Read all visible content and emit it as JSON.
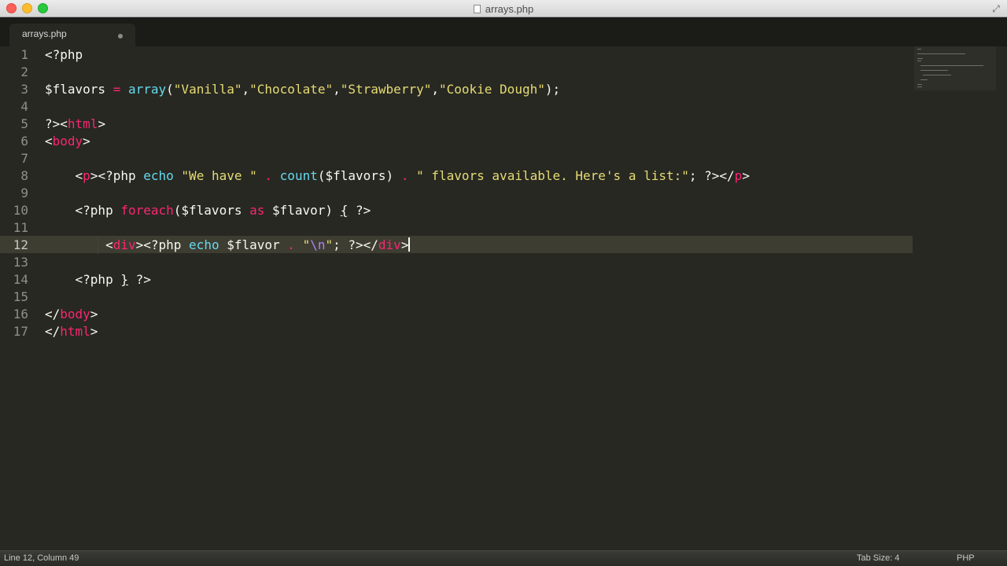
{
  "window": {
    "title": "arrays.php"
  },
  "tabs": [
    {
      "label": "arrays.php",
      "dirty": true
    }
  ],
  "editor": {
    "line_numbers": [
      "1",
      "2",
      "3",
      "4",
      "5",
      "6",
      "7",
      "8",
      "9",
      "10",
      "11",
      "12",
      "13",
      "14",
      "15",
      "16",
      "17"
    ],
    "active_line": 12,
    "lines": [
      [
        [
          "<?php",
          "plain"
        ]
      ],
      [],
      [
        [
          "$flavors ",
          "plain"
        ],
        [
          "=",
          "op"
        ],
        [
          " ",
          "plain"
        ],
        [
          "array",
          "fn"
        ],
        [
          "(",
          "plain"
        ],
        [
          "\"Vanilla\"",
          "str"
        ],
        [
          ",",
          "plain"
        ],
        [
          "\"Chocolate\"",
          "str"
        ],
        [
          ",",
          "plain"
        ],
        [
          "\"Strawberry\"",
          "str"
        ],
        [
          ",",
          "plain"
        ],
        [
          "\"Cookie Dough\"",
          "str"
        ],
        [
          ");",
          "plain"
        ]
      ],
      [],
      [
        [
          "?><",
          "plain"
        ],
        [
          "html",
          "tag"
        ],
        [
          ">",
          "plain"
        ]
      ],
      [
        [
          "<",
          "plain"
        ],
        [
          "body",
          "tag"
        ],
        [
          ">",
          "plain"
        ]
      ],
      [],
      [
        [
          "    <",
          "plain"
        ],
        [
          "p",
          "tag"
        ],
        [
          "><?php ",
          "plain"
        ],
        [
          "echo",
          "fn"
        ],
        [
          " ",
          "plain"
        ],
        [
          "\"We have \"",
          "str"
        ],
        [
          " ",
          "plain"
        ],
        [
          ".",
          "op"
        ],
        [
          " ",
          "plain"
        ],
        [
          "count",
          "fn"
        ],
        [
          "($flavors) ",
          "plain"
        ],
        [
          ".",
          "op"
        ],
        [
          " ",
          "plain"
        ],
        [
          "\" flavors available. Here's a list:\"",
          "str"
        ],
        [
          "; ?></",
          "plain"
        ],
        [
          "p",
          "tag"
        ],
        [
          ">",
          "plain"
        ]
      ],
      [],
      [
        [
          "    <?php ",
          "plain"
        ],
        [
          "foreach",
          "kw"
        ],
        [
          "($flavors ",
          "plain"
        ],
        [
          "as",
          "kw"
        ],
        [
          " $flavor) ",
          "plain"
        ],
        [
          "{",
          "under"
        ],
        [
          " ?>",
          "plain"
        ]
      ],
      [],
      [
        [
          "        <",
          "plain"
        ],
        [
          "div",
          "tag"
        ],
        [
          "><?php ",
          "plain"
        ],
        [
          "echo",
          "fn"
        ],
        [
          " $flavor ",
          "plain"
        ],
        [
          ".",
          "op"
        ],
        [
          " ",
          "plain"
        ],
        [
          "\"",
          "str"
        ],
        [
          "\\n",
          "esc"
        ],
        [
          "\"",
          "str"
        ],
        [
          "; ?></",
          "plain"
        ],
        [
          "div",
          "tag"
        ],
        [
          ">",
          "plain"
        ]
      ],
      [],
      [
        [
          "    <?php ",
          "plain"
        ],
        [
          "}",
          "under"
        ],
        [
          " ?>",
          "plain"
        ]
      ],
      [],
      [
        [
          "</",
          "plain"
        ],
        [
          "body",
          "tag"
        ],
        [
          ">",
          "plain"
        ]
      ],
      [
        [
          "</",
          "plain"
        ],
        [
          "html",
          "tag"
        ],
        [
          ">",
          "plain"
        ]
      ]
    ]
  },
  "status": {
    "position": "Line 12, Column 49",
    "tab_size": "Tab Size: 4",
    "syntax": "PHP"
  },
  "colors": {
    "background": "#272822",
    "tag": "#f92672",
    "function": "#66d9ef",
    "string": "#e6db74",
    "escape": "#ae81ff"
  }
}
